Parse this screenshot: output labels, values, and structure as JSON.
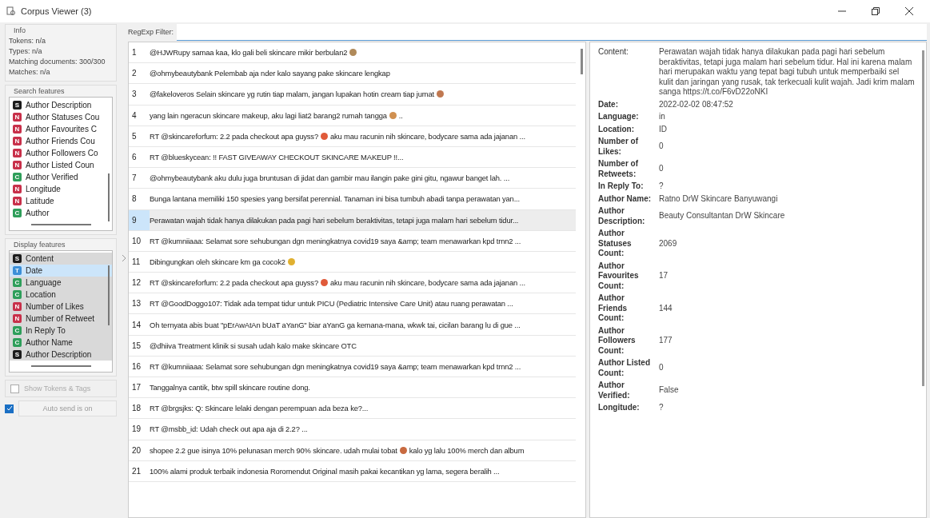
{
  "window": {
    "title": "Corpus Viewer (3)"
  },
  "info": {
    "title": "Info",
    "lines": [
      "Tokens: n/a",
      "Types: n/a",
      "Matching documents: 300/300",
      "Matches: n/a"
    ]
  },
  "search_features": {
    "title": "Search features",
    "items": [
      {
        "type": "S",
        "label": "Author Description"
      },
      {
        "type": "N",
        "label": "Author Statuses Cou"
      },
      {
        "type": "N",
        "label": "Author Favourites C"
      },
      {
        "type": "N",
        "label": "Author Friends Cou"
      },
      {
        "type": "N",
        "label": "Author Followers Co"
      },
      {
        "type": "N",
        "label": "Author Listed Coun"
      },
      {
        "type": "C",
        "label": "Author Verified"
      },
      {
        "type": "N",
        "label": "Longitude"
      },
      {
        "type": "N",
        "label": "Latitude"
      },
      {
        "type": "C",
        "label": "Author"
      }
    ]
  },
  "display_features": {
    "title": "Display features",
    "items": [
      {
        "type": "S",
        "label": "Content",
        "selected": true,
        "focused": false
      },
      {
        "type": "T",
        "label": "Date",
        "selected": true,
        "focused": true
      },
      {
        "type": "C",
        "label": "Language",
        "selected": true,
        "focused": false
      },
      {
        "type": "C",
        "label": "Location",
        "selected": true,
        "focused": false
      },
      {
        "type": "N",
        "label": "Number of Likes",
        "selected": true,
        "focused": false
      },
      {
        "type": "N",
        "label": "Number of Retweet",
        "selected": true,
        "focused": false
      },
      {
        "type": "C",
        "label": "In Reply To",
        "selected": true,
        "focused": false
      },
      {
        "type": "C",
        "label": "Author Name",
        "selected": true,
        "focused": false
      },
      {
        "type": "S",
        "label": "Author Description",
        "selected": true,
        "focused": false
      }
    ]
  },
  "show_tokens": {
    "label": "Show Tokens & Tags",
    "checked": false,
    "disabled": true
  },
  "auto_send": {
    "checked": true,
    "button": "Auto send is on"
  },
  "filter": {
    "label": "RegExp Filter:"
  },
  "documents": [
    {
      "number": "1",
      "text": "@HJWRupy samaa kaa, klo gali beli skincare mikir berbulan2",
      "emoji": {
        "color": "#b08a5a"
      },
      "selected": false
    },
    {
      "number": "2",
      "text": "@ohmybeautybank Pelembab aja nder kalo sayang pake skincare lengkap",
      "selected": false
    },
    {
      "number": "3",
      "text": "@fakeloveros Selain skincare yg rutin tiap malam, jangan lupakan hotin cream tiap jumat",
      "emoji": {
        "color": "#c07850"
      },
      "selected": false
    },
    {
      "number": "4",
      "text": "yang lain ngeracun skincare makeup, aku lagi liat2 barang2 rumah tangga",
      "emoji": {
        "color": "#d09050"
      },
      "text_after": "..",
      "selected": false
    },
    {
      "number": "5",
      "text": "RT @skincareforfum: 2.2 pada checkout apa guyss?",
      "emoji": {
        "color": "#e05a3a"
      },
      "text_after": "aku mau racunin nih skincare, bodycare sama ada jajanan ...",
      "selected": false
    },
    {
      "number": "6",
      "text": "RT @blueskycean: !! FAST GIVEAWAY CHECKOUT SKINCARE MAKEUP !!...",
      "selected": false
    },
    {
      "number": "7",
      "text": "@ohmybeautybank aku dulu juga bruntusan di jidat dan gambir mau ilangin pake gini gitu, ngawur banget lah. ...",
      "selected": false
    },
    {
      "number": "8",
      "text": "Bunga lantana memiliki 150 spesies yang bersifat perennial. Tanaman ini bisa tumbuh abadi tanpa perawatan yan...",
      "selected": false
    },
    {
      "number": "9",
      "text": "Perawatan wajah tidak hanya dilakukan pada pagi hari sebelum beraktivitas, tetapi juga malam hari sebelum tidur...",
      "selected": true
    },
    {
      "number": "10",
      "text": "RT @kumniiaaa: Selamat sore sehubungan dgn meningkatnya covid19 saya &amp; team menawarkan kpd trnn2 ...",
      "selected": false
    },
    {
      "number": "11",
      "text": "Dibingungkan oleh skincare km ga cocok2",
      "emoji": {
        "color": "#e0b030"
      },
      "selected": false
    },
    {
      "number": "12",
      "text": "RT @skincareforfum: 2.2 pada checkout apa guyss?",
      "emoji": {
        "color": "#e05a3a"
      },
      "text_after": "aku mau racunin nih skincare, bodycare sama ada jajanan ...",
      "selected": false
    },
    {
      "number": "13",
      "text": "RT @GoodDoggo107: Tidak ada tempat tidur untuk PICU (Pediatric Intensive Care Unit) atau ruang perawatan ...",
      "selected": false
    },
    {
      "number": "14",
      "text": "Oh ternyata abis buat \"pErAwAtAn bUaT aYanG\" biar aYanG ga kemana-mana, wkwk tai, cicilan barang lu di gue ...",
      "selected": false
    },
    {
      "number": "15",
      "text": "@dhiiva Treatment klinik si susah udah kalo make skincare OTC",
      "selected": false
    },
    {
      "number": "16",
      "text": "RT @kumniiaaa: Selamat sore sehubungan dgn meningkatnya covid19 saya &amp; team menawarkan kpd trnn2 ...",
      "selected": false
    },
    {
      "number": "17",
      "text": "Tanggalnya cantik, btw spill skincare routine dong.",
      "selected": false
    },
    {
      "number": "18",
      "text": "RT @brgsjks: Q: Skincare lelaki dengan perempuan ada beza ke?...",
      "selected": false
    },
    {
      "number": "19",
      "text": "RT @msbb_id: Udah check out apa aja di 2.2? ...",
      "selected": false
    },
    {
      "number": "20",
      "text": "shopee 2.2 gue isinya 10% pelunasan merch 90% skincare. udah mulai tobat",
      "emoji": {
        "color": "#c86a40"
      },
      "text_after": "kalo yg lalu 100% merch dan album",
      "selected": false
    },
    {
      "number": "21",
      "text": "100% alami produk terbaik indonesia Roromendut Original masih pakai kecantikan yg lama, segera beralih ...",
      "selected": false
    }
  ],
  "details": [
    {
      "label": "Content:",
      "value": "Perawatan wajah tidak hanya dilakukan pada pagi hari sebelum beraktivitas, tetapi juga malam hari sebelum tidur. Hal ini karena malam hari merupakan waktu yang tepat bagi tubuh untuk memperbaiki sel kulit dan jaringan yang rusak, tak terkecuali kulit wajah. Jadi krim malam sanga https://t.co/F6vD22oNKI"
    },
    {
      "label": "Date:",
      "value": "2022-02-02 08:47:52"
    },
    {
      "label": "Language:",
      "value": "in"
    },
    {
      "label": "Location:",
      "value": "ID"
    },
    {
      "label": "Number of Likes:",
      "value": "0"
    },
    {
      "label": "Number of Retweets:",
      "value": "0"
    },
    {
      "label": "In Reply To:",
      "value": "?"
    },
    {
      "label": "Author Name:",
      "value": "Ratno DrW Skincare Banyuwangi"
    },
    {
      "label": "Author Description:",
      "value": "Beauty Consultantan DrW Skincare"
    },
    {
      "label": "Author Statuses Count:",
      "value": "2069"
    },
    {
      "label": "Author Favourites Count:",
      "value": "17"
    },
    {
      "label": "Author Friends Count:",
      "value": "144"
    },
    {
      "label": "Author Followers Count:",
      "value": "177"
    },
    {
      "label": "Author Listed Count:",
      "value": "0"
    },
    {
      "label": "Author Verified:",
      "value": "False"
    },
    {
      "label": "Longitude:",
      "value": "?"
    }
  ]
}
